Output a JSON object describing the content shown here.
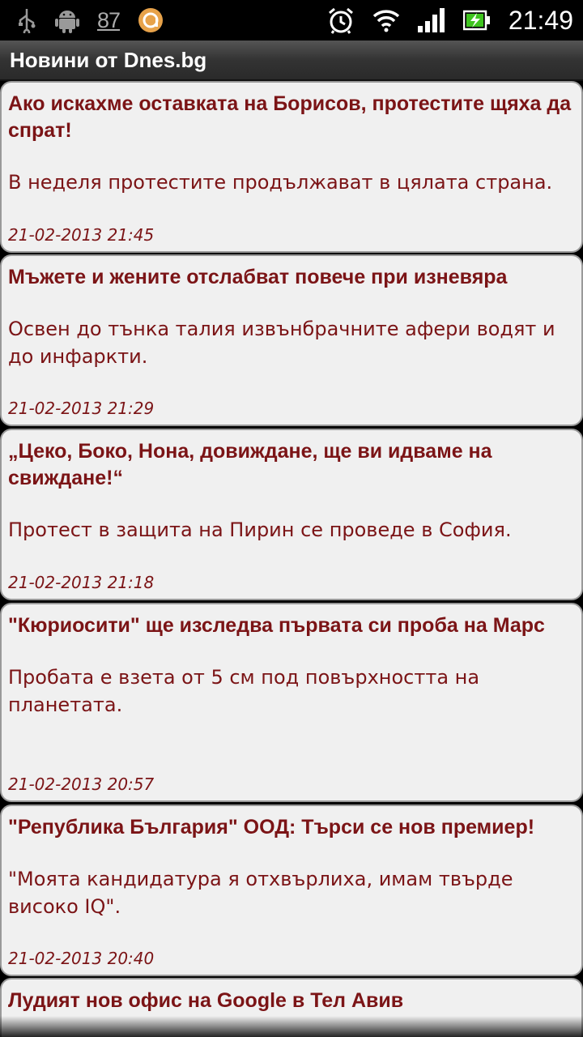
{
  "status_bar": {
    "icons_left": [
      "usb-icon",
      "android-debug-icon"
    ],
    "notification_count": "87",
    "icons_right": [
      "alarm-icon",
      "wifi-icon",
      "signal-icon",
      "battery-charging-icon"
    ],
    "time": "21:49"
  },
  "app": {
    "title": "Новини от Dnes.bg"
  },
  "colors": {
    "accent": "#7b1416",
    "card_bg": "#f0f0f0"
  },
  "news": [
    {
      "title": "Ако искахме оставката на Борисов, протестите щяха да спрат!",
      "summary": "В неделя протестите продължават в цялата страна.",
      "date": "21-02-2013 21:45"
    },
    {
      "title": "Мъжете и жените отслабват повече при изневяра",
      "summary": "Освен до тънка талия извънбрачните афери водят и до инфаркти.",
      "date": "21-02-2013 21:29"
    },
    {
      "title": "„Цеко, Боко, Нона, довиждане, ще ви идваме на свиждане!“",
      "summary": "Протест в защита на Пирин се проведе в София.",
      "date": "21-02-2013 21:18"
    },
    {
      "title": "\"Кюриосити\" ще изследва първата си проба на Марс",
      "summary": "Пробата е взета от 5 см под повърхността на планетата.",
      "date": "21-02-2013 20:57"
    },
    {
      "title": "\"Република България\" ООД: Търси се нов премиер!",
      "summary": "\"Моята кандидатура я отхвърлиха, имам твърде високо IQ\".",
      "date": "21-02-2013 20:40"
    },
    {
      "title": "Лудият нов офис на Google в Тел Авив",
      "summary": "",
      "date": ""
    }
  ]
}
